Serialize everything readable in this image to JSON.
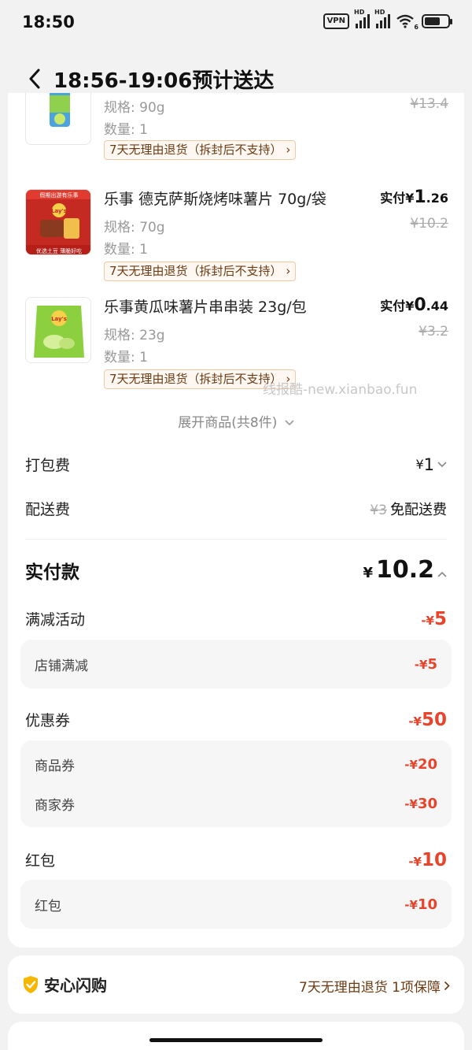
{
  "status_bar": {
    "time": "18:50",
    "vpn": "VPN",
    "hd1": "HD",
    "hd2": "HD",
    "wifi_badge": "6"
  },
  "header": {
    "title": "18:56-19:06预计送达"
  },
  "products": [
    {
      "name": "",
      "spec": "规格: 90g",
      "qty": "数量: 1",
      "tag": "7天无理由退货（拆封后不支持）",
      "pay_label": "",
      "pay_int": "",
      "pay_dec": "",
      "orig": "¥13.4"
    },
    {
      "name": "乐事 德克萨斯烧烤味薯片 70g/袋",
      "spec": "规格: 70g",
      "qty": "数量: 1",
      "tag": "7天无理由退货（拆封后不支持）",
      "pay_label": "实付",
      "pay_cur": "¥",
      "pay_int": "1",
      "pay_dec": ".26",
      "orig": "¥10.2",
      "thumb_top": "假期出游有乐事",
      "thumb_bottom": "优选土豆  薄脆好吃"
    },
    {
      "name": "乐事黄瓜味薯片串串装 23g/包",
      "spec": "规格: 23g",
      "qty": "数量: 1",
      "tag": "7天无理由退货（拆封后不支持）",
      "pay_label": "实付",
      "pay_cur": "¥",
      "pay_int": "0",
      "pay_dec": ".44",
      "orig": "¥3.2"
    }
  ],
  "watermark": "线报酷-new.xianbao.fun",
  "expand_label": "展开商品(共8件)",
  "packing_fee": {
    "label": "打包费",
    "cur": "¥",
    "value": "1"
  },
  "delivery_fee": {
    "label": "配送费",
    "original": "¥3",
    "value": "免配送费"
  },
  "total": {
    "label": "实付款",
    "cur": "¥",
    "value": "10.2"
  },
  "full_reduction": {
    "label": "满减活动",
    "cur": "-¥",
    "value": "5",
    "items": [
      {
        "label": "店铺满减",
        "cur": "-¥",
        "value": "5"
      }
    ]
  },
  "coupons": {
    "label": "优惠券",
    "cur": "-¥",
    "value": "50",
    "items": [
      {
        "label": "商品券",
        "cur": "-¥",
        "value": "20"
      },
      {
        "label": "商家券",
        "cur": "-¥",
        "value": "30"
      }
    ]
  },
  "red_packet": {
    "label": "红包",
    "cur": "-¥",
    "value": "10",
    "items": [
      {
        "label": "红包",
        "cur": "-¥",
        "value": "10"
      }
    ]
  },
  "insurance": {
    "title": "安心闪购",
    "detail": "7天无理由退货 1项保障"
  },
  "colors": {
    "discount_red": "#e8442c",
    "tag_brown": "#6b3a12",
    "insurance_gold": "#f5b700"
  }
}
